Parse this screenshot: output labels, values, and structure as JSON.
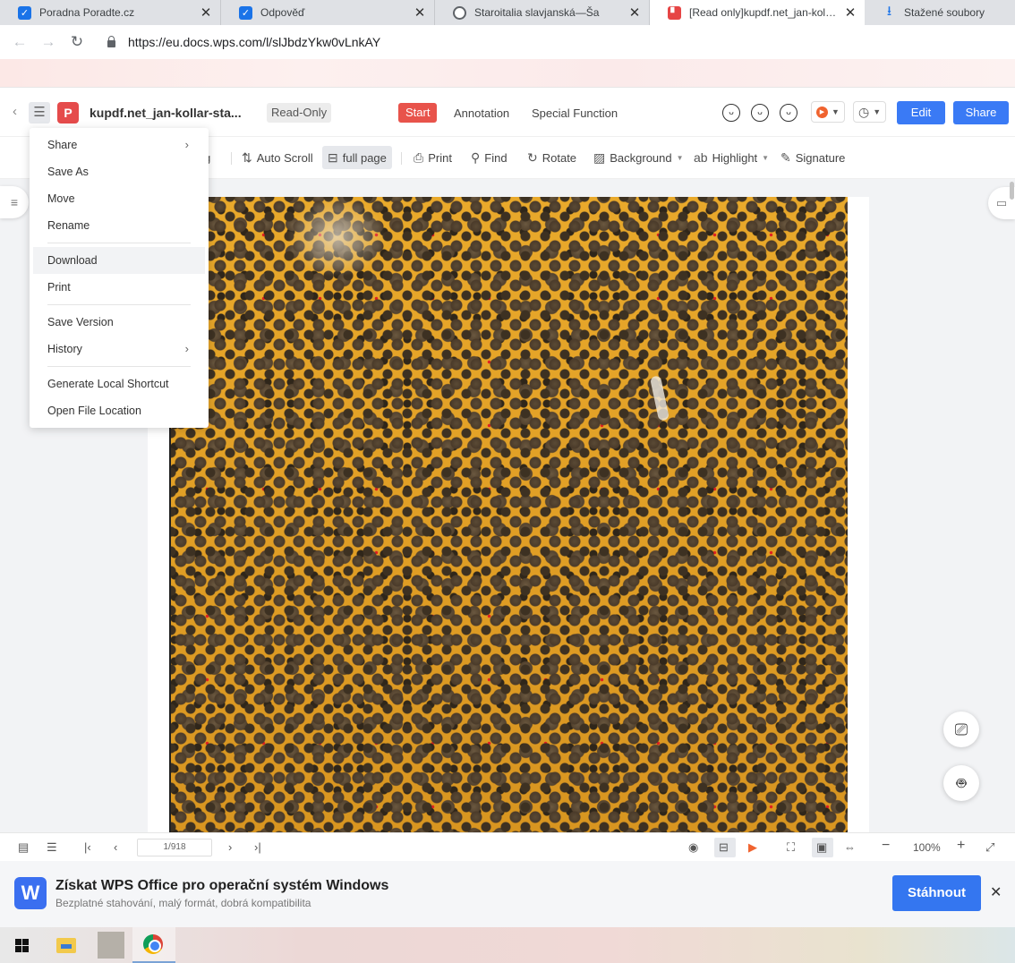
{
  "browser": {
    "tabs": [
      {
        "title": "Poradna Poradte.cz",
        "icon": "checkbox-icon"
      },
      {
        "title": "Odpověď",
        "icon": "checkbox-icon"
      },
      {
        "title": "Staroitalia slavjanská—Ša",
        "icon": "globe-icon"
      },
      {
        "title": "[Read only]kupdf.net_jan-kollar-s",
        "icon": "pdf-icon",
        "active": true
      },
      {
        "title": "Stažené soubory",
        "icon": "download-icon"
      }
    ],
    "tab_close": "✕",
    "url": "https://eu.docs.wps.com/l/slJbdzYkw0vLnkAY"
  },
  "header": {
    "filename": "kupdf.net_jan-kollar-sta...",
    "readonly_badge": "Read-Only",
    "tabs": [
      "Start",
      "Annotation",
      "Special Function"
    ],
    "edit_label": "Edit",
    "share_label": "Share"
  },
  "toolbar": {
    "partial_label": "g",
    "auto_scroll": "Auto Scroll",
    "full_page": "full page",
    "print": "Print",
    "find": "Find",
    "rotate": "Rotate",
    "background": "Background",
    "highlight": "Highlight",
    "signature": "Signature"
  },
  "menu": {
    "items": [
      {
        "label": "Share",
        "submenu": true
      },
      {
        "label": "Save As"
      },
      {
        "label": "Move"
      },
      {
        "label": "Rename"
      },
      {
        "label": "Download",
        "hovered": true
      },
      {
        "label": "Print"
      },
      {
        "label": "Save Version"
      },
      {
        "label": "History",
        "submenu": true
      },
      {
        "label": "Generate Local Shortcut"
      },
      {
        "label": "Open File Location"
      }
    ]
  },
  "statusbar": {
    "page_indicator": "1/918",
    "zoom": "100%"
  },
  "banner": {
    "title": "Získat WPS Office pro operační systém Windows",
    "subtitle": "Bezplatné stahování, malý formát, dobrá kompatibilita",
    "button": "Stáhnout",
    "close": "✕"
  },
  "colors": {
    "accent_red": "#e8534b",
    "accent_blue": "#3a7af5"
  }
}
